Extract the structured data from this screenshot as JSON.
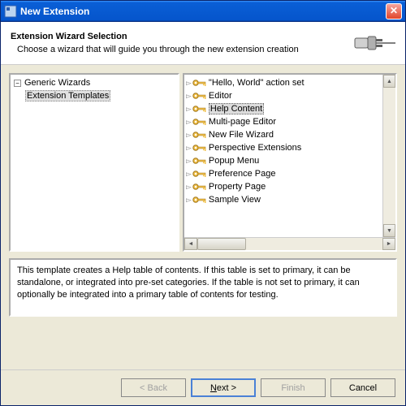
{
  "title": "New Extension",
  "banner": {
    "heading": "Extension Wizard Selection",
    "subtext": "Choose a wizard that will guide you through the new extension creation"
  },
  "tree": {
    "items": [
      {
        "label": "Generic Wizards",
        "selected": false
      },
      {
        "label": "Extension Templates",
        "selected": true
      }
    ]
  },
  "list": {
    "items": [
      {
        "label": "\"Hello, World\" action set",
        "selected": false
      },
      {
        "label": "Editor",
        "selected": false
      },
      {
        "label": "Help Content",
        "selected": true
      },
      {
        "label": "Multi-page Editor",
        "selected": false
      },
      {
        "label": "New File Wizard",
        "selected": false
      },
      {
        "label": "Perspective Extensions",
        "selected": false
      },
      {
        "label": "Popup Menu",
        "selected": false
      },
      {
        "label": "Preference Page",
        "selected": false
      },
      {
        "label": "Property Page",
        "selected": false
      },
      {
        "label": "Sample View",
        "selected": false
      }
    ]
  },
  "description": "This template creates a Help table of contents. If this table is set to primary, it can be standalone, or integrated into pre-set categories. If the table is not set to primary, it can optionally be integrated into a primary table of contents for testing.",
  "buttons": {
    "back": "< Back",
    "next_prefix": "N",
    "next_suffix": "ext >",
    "finish": "Finish",
    "cancel": "Cancel"
  }
}
